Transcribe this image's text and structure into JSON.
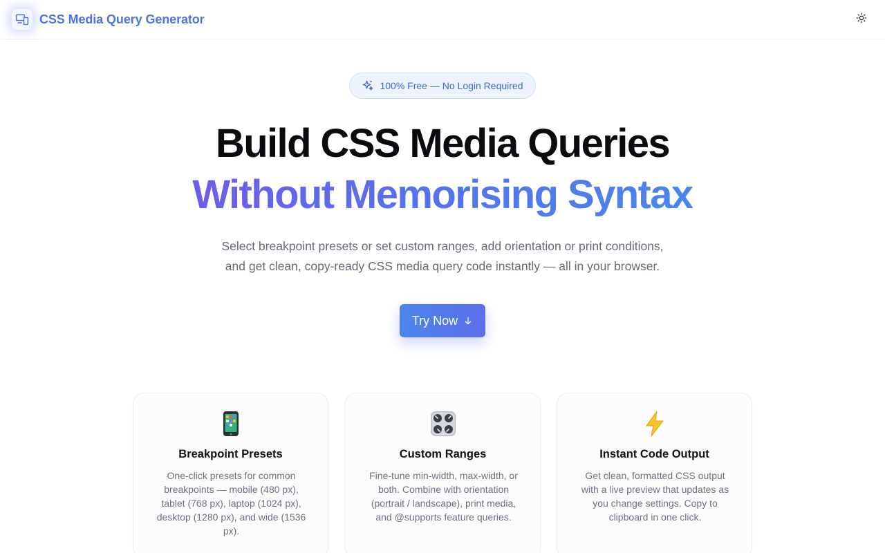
{
  "header": {
    "brand_name": "CSS Media Query Generator",
    "logo_icon": "devices-icon",
    "theme_icon": "sun-icon"
  },
  "hero": {
    "badge_icon": "sparkles-icon",
    "badge_text": "100% Free — No Login Required",
    "title_line1": "Build CSS Media Queries",
    "title_line2": "Without Memorising Syntax",
    "subtitle_line1": "Select breakpoint presets or set custom ranges, add orientation or print conditions,",
    "subtitle_line2": "and get clean, copy-ready CSS media query code instantly — all in your browser.",
    "cta_label": "Try Now",
    "cta_icon": "arrow-down-icon"
  },
  "features": [
    {
      "icon": "mobile-phone-icon",
      "title": "Breakpoint Presets",
      "description": "One-click presets for common breakpoints — mobile (480 px), tablet (768 px), laptop (1024 px), desktop (1280 px), and wide (1536 px)."
    },
    {
      "icon": "control-knobs-icon",
      "title": "Custom Ranges",
      "description": "Fine-tune min-width, max-width, or both. Combine with orientation (portrait / landscape), print media, and @supports feature queries."
    },
    {
      "icon": "lightning-icon",
      "title": "Instant Code Output",
      "description": "Get clean, formatted CSS output with a live preview that updates as you change settings. Copy to clipboard in one click."
    }
  ],
  "colors": {
    "brand": "#4f73e6",
    "gradient_start": "#6c5ee8",
    "gradient_end": "#4a86ea",
    "badge_bg": "#edf2fd"
  }
}
